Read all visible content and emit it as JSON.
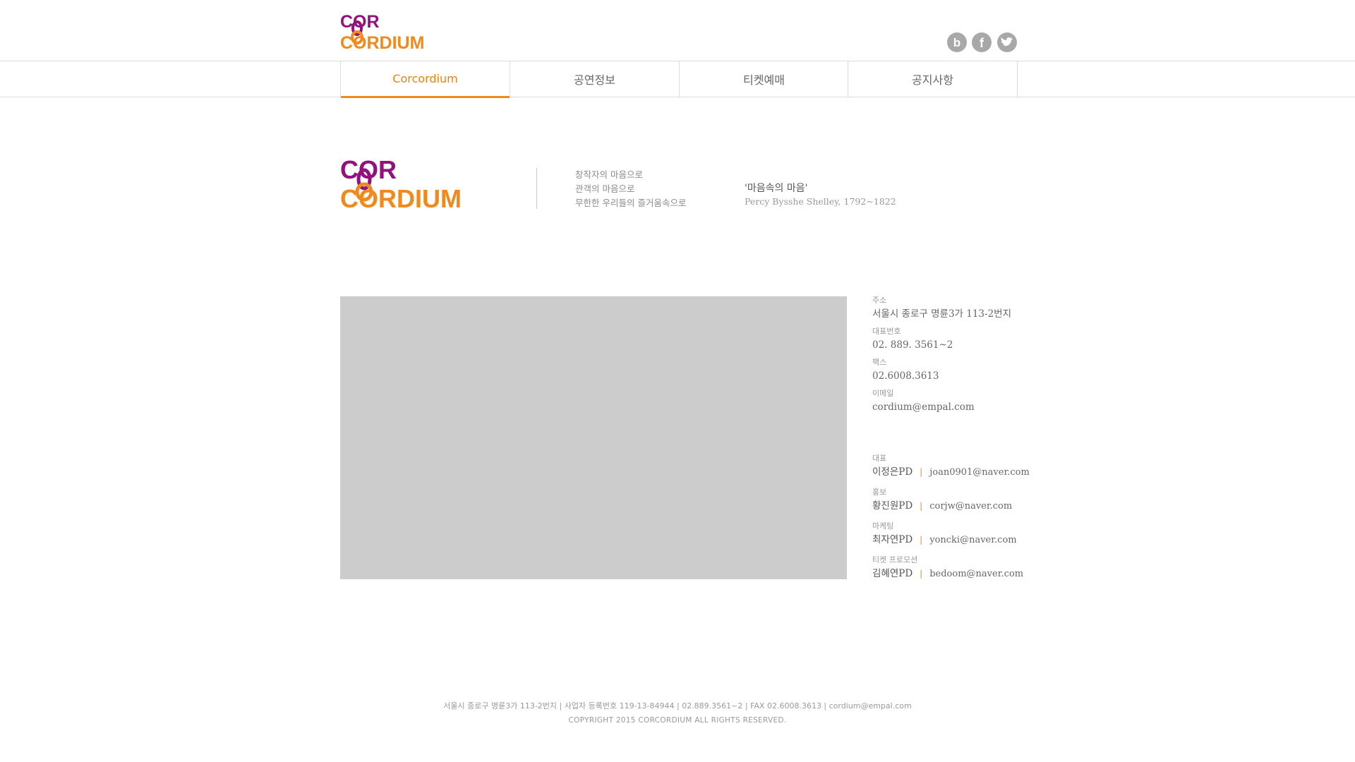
{
  "brand": {
    "logo_line1": "COR",
    "logo_line2": "CORDIUM",
    "purple": "#93117e",
    "orange": "#f08a1c"
  },
  "social": [
    {
      "name": "blog-icon",
      "glyph": "b"
    },
    {
      "name": "facebook-icon",
      "glyph": "f"
    },
    {
      "name": "twitter-icon",
      "glyph": "bird"
    }
  ],
  "nav": {
    "items": [
      {
        "label": "Corcordium",
        "active": true
      },
      {
        "label": "공연정보",
        "active": false
      },
      {
        "label": "티켓예매",
        "active": false
      },
      {
        "label": "공지사항",
        "active": false
      }
    ]
  },
  "intro": {
    "lines": [
      "창작자의 마음으로",
      "관객의 마음으로",
      "무한한 우리들의 즐거움속으로"
    ],
    "quote_title": "'마음속의 마음'",
    "quote_source": "Percy Bysshe Shelley, 1792~1822"
  },
  "contact": {
    "address_label": "주소",
    "address": "서울시 종로구 명륜3가 113-2번지",
    "phone_label": "대표번호",
    "phone": "02. 889. 3561~2",
    "fax_label": "팩스",
    "fax": "02.6008.3613",
    "email_label": "이메일",
    "email": "cordium@empal.com"
  },
  "staff": [
    {
      "role": "대표",
      "name": "이정은PD",
      "email": "joan0901@naver.com"
    },
    {
      "role": "홍보",
      "name": "황진원PD",
      "email": "corjw@naver.com"
    },
    {
      "role": "마케팅",
      "name": "최자연PD",
      "email": "yoncki@naver.com"
    },
    {
      "role": "티켓 프로모션",
      "name": "김혜연PD",
      "email": "bedoom@naver.com"
    }
  ],
  "footer": {
    "line1": "서울시 종로구 명륜3가 113-2번지 | 사업자 등록번호 119-13-84944 | 02.889.3561~2 | FAX 02.6008.3613 | cordium@empal.com",
    "line2": "COPYRIGHT 2015 CORCORDIUM ALL RIGHTS RESERVED."
  }
}
